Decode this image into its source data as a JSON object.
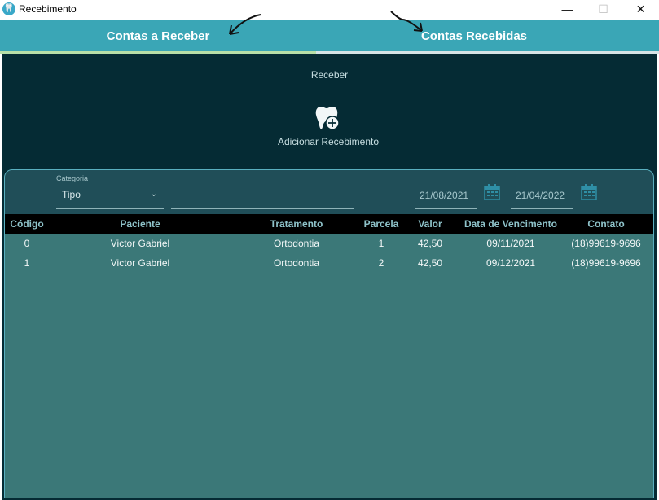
{
  "window": {
    "title": "Recebimento",
    "minimize": "—",
    "maximize": "☐",
    "close": "✕"
  },
  "tabs": [
    {
      "label": "Contas a Receber",
      "active": true
    },
    {
      "label": "Contas Recebidas",
      "active": false
    }
  ],
  "main": {
    "section_title": "Receber",
    "add_button_label": "Adicionar Recebimento"
  },
  "filters": {
    "category_label": "Categoria",
    "category_value": "Tipo",
    "search_value": "",
    "date_from": "21/08/2021",
    "date_to": "21/04/2022"
  },
  "table": {
    "columns": [
      "Código",
      "Paciente",
      "Tratamento",
      "Parcela",
      "Valor",
      "Data de Vencimento",
      "Contato"
    ],
    "rows": [
      [
        "0",
        "Victor Gabriel",
        "Ortodontia",
        "1",
        "42,50",
        "09/11/2021",
        "(18)99619-9696"
      ],
      [
        "1",
        "Victor Gabriel",
        "Ortodontia",
        "2",
        "42,50",
        "09/12/2021",
        "(18)99619-9696"
      ]
    ]
  },
  "colors": {
    "tab_bar": "#3aa6b6",
    "content_bg": "#052b34",
    "table_bg": "#3b7878",
    "header_text": "#8fc3ca"
  }
}
